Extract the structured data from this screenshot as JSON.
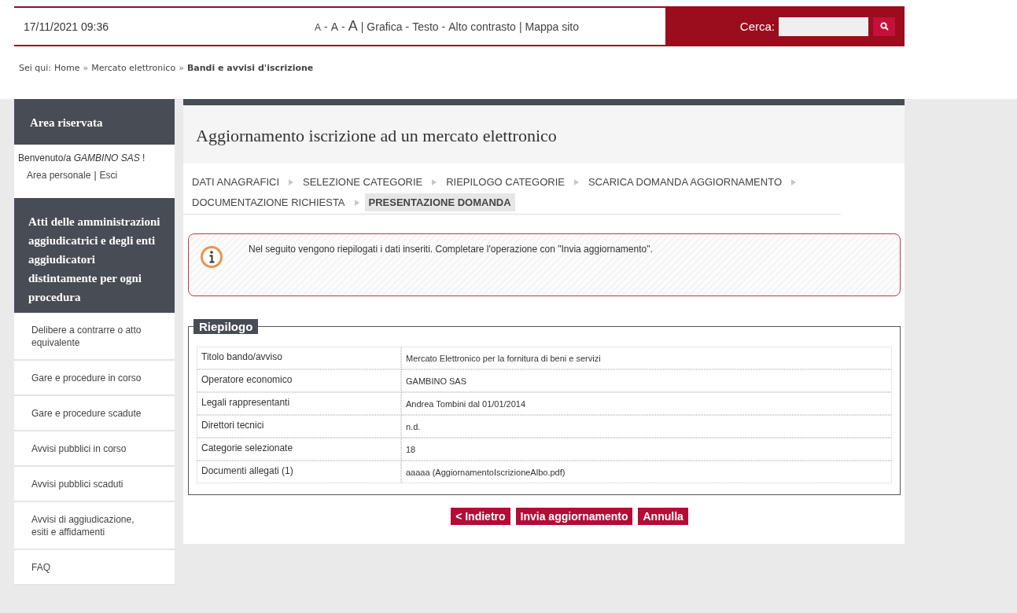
{
  "header": {
    "datetime": "17/11/2021 09:36",
    "tools": [
      {
        "kind": "small",
        "text": "A"
      },
      {
        "kind": "sep",
        "text": "-"
      },
      {
        "kind": "medium",
        "text": "A"
      },
      {
        "kind": "sep",
        "text": "-"
      },
      {
        "kind": "large",
        "text": "A"
      },
      {
        "kind": "sep",
        "text": "|"
      },
      {
        "kind": "link",
        "text": "Grafica"
      },
      {
        "kind": "sep",
        "text": "-"
      },
      {
        "kind": "link",
        "text": "Testo"
      },
      {
        "kind": "sep",
        "text": "-"
      },
      {
        "kind": "link",
        "text": "Alto contrasto"
      },
      {
        "kind": "sep",
        "text": "|"
      },
      {
        "kind": "link",
        "text": "Mappa sito"
      }
    ],
    "search_label": "Cerca:"
  },
  "breadcrumb": {
    "label": "Sei qui:",
    "items": [
      {
        "kind": "link",
        "text": "Home"
      },
      {
        "kind": "sep",
        "text": "»"
      },
      {
        "kind": "link",
        "text": "Mercato elettronico"
      },
      {
        "kind": "sep",
        "text": "»"
      },
      {
        "kind": "current",
        "text": "Bandi e avvisi d'iscrizione"
      }
    ]
  },
  "sidebar": {
    "title": "Area riservata",
    "welcome": "Benvenuto/a *GAMBINO SAS* !",
    "user_links": [
      {
        "kind": "link",
        "text": "Area personale"
      },
      {
        "kind": "sep",
        "text": "|"
      },
      {
        "kind": "link",
        "text": "Esci"
      }
    ],
    "section_title": "Atti delle amministrazioni aggiudicatrici e degli enti aggiudicatori distintamente per ogni procedura",
    "items": [
      "Delibere a contrarre o atto equivalente",
      "Gare e procedure in corso",
      "Gare e procedure scadute",
      "Avvisi pubblici in corso",
      "Avvisi pubblici scaduti",
      "Avvisi di aggiudicazione, esiti e affidamenti",
      "FAQ"
    ]
  },
  "main": {
    "title": "Aggiornamento iscrizione ad un mercato elettronico",
    "steps": [
      {
        "label": "DATI ANAGRAFICI",
        "selected": false
      },
      {
        "label": "SELEZIONE CATEGORIE",
        "selected": false
      },
      {
        "label": "RIEPILOGO CATEGORIE",
        "selected": false
      },
      {
        "label": "SCARICA DOMANDA AGGIORNAMENTO",
        "selected": false
      },
      {
        "label": "DOCUMENTAZIONE RICHIESTA",
        "selected": false
      },
      {
        "label": "PRESENTAZIONE DOMANDA",
        "selected": true
      }
    ],
    "info": "Nel seguito vengono riepilogati i dati inseriti. Completare l'operazione con \"Invia aggiornamento\".",
    "summary": {
      "legend": "Riepilogo",
      "rows": [
        {
          "label": "Titolo bando/avviso",
          "value": "Mercato Elettronico per la fornitura di beni e servizi"
        },
        {
          "label": "Operatore economico",
          "value": "GAMBINO SAS"
        },
        {
          "label": "Legali rappresentanti",
          "value": "Andrea Tombini dal 01/01/2014"
        },
        {
          "label": "Direttori tecnici",
          "value": "n.d."
        },
        {
          "label": "Categorie selezionate",
          "value": "18"
        },
        {
          "label": "Documenti allegati (1)",
          "value": "aaaaa (AggiornamentoIscrizioneAlbo.pdf)"
        }
      ]
    },
    "buttons": [
      "< Indietro",
      "Invia aggiornamento",
      "Annulla"
    ]
  }
}
